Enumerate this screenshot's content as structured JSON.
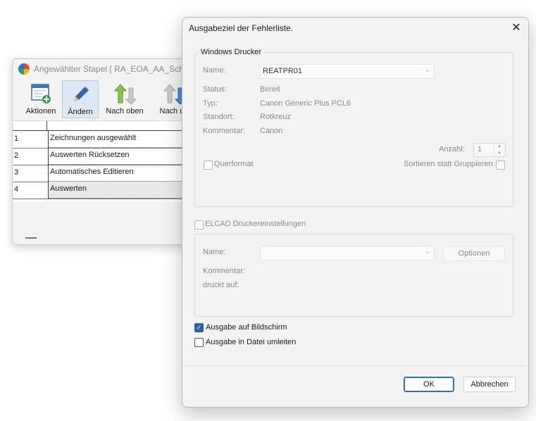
{
  "batch_window": {
    "title": "Angewählter Stapel  [ RA_EOA_AA_Sche",
    "toolbar": [
      {
        "label": "Aktionen",
        "icon": "table-add-icon"
      },
      {
        "label": "Ändern",
        "icon": "pencil-icon"
      },
      {
        "label": "Nach oben",
        "icon": "move-up-icon"
      },
      {
        "label": "Nach un",
        "icon": "move-down-icon"
      }
    ],
    "rows": [
      {
        "num": "1",
        "text": "Zeichnungen ausgewählt"
      },
      {
        "num": "2",
        "text": "Auswerten Rücksetzen"
      },
      {
        "num": "3",
        "text": "Automatisches Editieren"
      },
      {
        "num": "4",
        "text": "Auswerten"
      }
    ]
  },
  "dialog": {
    "title": "Ausgabeziel der Fehlerliste.",
    "close": "✕",
    "windows_printer": {
      "legend": "Windows Drucker",
      "name_label": "Name:",
      "name_value": "REATPR01",
      "status_label": "Status:",
      "status_value": "Bereit",
      "type_label": "Typ:",
      "type_value": "Canon Generic Plus PCL6",
      "location_label": "Standort:",
      "location_value": "Rotkreuz",
      "comment_label": "Kommentar:",
      "comment_value": "Canon",
      "count_label": "Anzahl:",
      "count_value": "1",
      "landscape_label": "Querformat",
      "collate_label": "Sortieren statt Gruppieren"
    },
    "elcad": {
      "checkbox_label": "ELCAD Druckereinstellungen",
      "name_label": "Name:",
      "name_value": "",
      "options_button": "Optionen",
      "comment_label": "Kommentar:",
      "prints_on_label": "druckt auf:"
    },
    "output_screen": {
      "label": "Ausgabe auf Bildschirm",
      "checked": true
    },
    "output_file": {
      "label": "Ausgabe in Datei umleiten",
      "checked": false
    },
    "ok_button": "OK",
    "cancel_button": "Abbrechen"
  }
}
